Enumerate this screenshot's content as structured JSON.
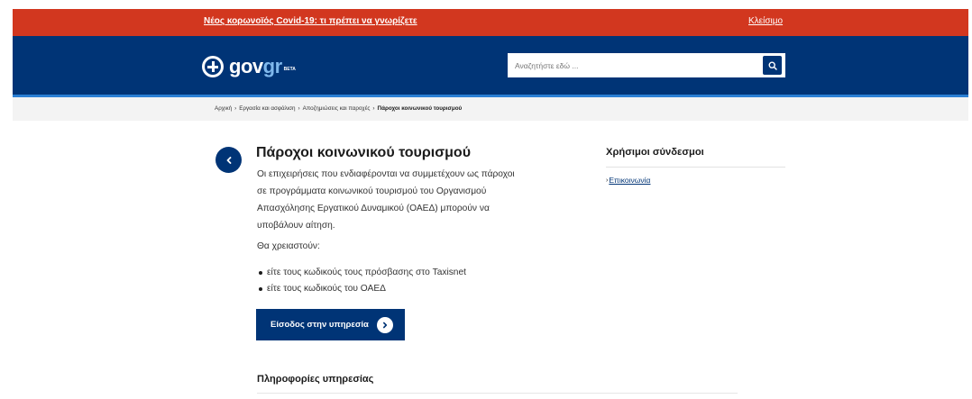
{
  "alert": {
    "message": "Νέος κορωνοϊός Covid-19: τι πρέπει να γνωρίζετε",
    "close_label": "Κλείσιμο",
    "color": "#d2371f"
  },
  "header": {
    "logo_text_main": "gov",
    "logo_text_accent": "gr",
    "logo_badge": "BETA",
    "color": "#003476",
    "accent_color": "#2a7fd4"
  },
  "search": {
    "placeholder": "Αναζητήστε εδώ ...",
    "icon": "search-icon"
  },
  "breadcrumb": {
    "items": [
      "Αρχική",
      "Εργασία και ασφάλιση",
      "Αποζημιώσεις και παροχές"
    ],
    "current": "Πάροχοι κοινωνικού τουρισμού",
    "separator": "›"
  },
  "main": {
    "title": "Πάροχοι κοινωνικού τουρισμού",
    "intro": "Οι επιχειρήσεις που ενδιαφέρονται να συμμετέχουν ως πάροχοι σε προγράμματα κοινωνικού τουρισμού του Οργανισμού Απασχόλησης Εργατικού Δυναμικού (ΟΑΕΔ) μπορούν να υποβάλουν αίτηση.",
    "needs_label": "Θα χρειαστούν:",
    "requirements": [
      "είτε τους κωδικούς τους πρόσβασης στο Taxisnet",
      "είτε τους κωδικούς του ΟΑΕΔ"
    ],
    "cta_label": "Είσοδος στην υπηρεσία",
    "info_heading": "Πληροφορίες υπηρεσίας"
  },
  "sidebar": {
    "heading": "Χρήσιμοι σύνδεσμοι",
    "links": [
      {
        "label": "Επικοινωνία"
      }
    ]
  }
}
